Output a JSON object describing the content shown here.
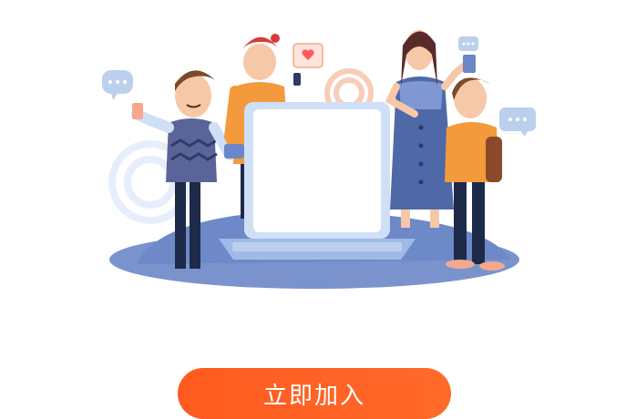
{
  "illustration": {
    "description_icon": "people-with-laptop-illustration",
    "colors": {
      "ground": "#6e89c8",
      "laptop_frame": "#cfe0f6",
      "laptop_screen": "#ffffff",
      "accent_orange": "#ff5a1f",
      "bubble": "#bcd0ee"
    }
  },
  "cta": {
    "label": "立即加入",
    "color": "#ff5a1f"
  }
}
